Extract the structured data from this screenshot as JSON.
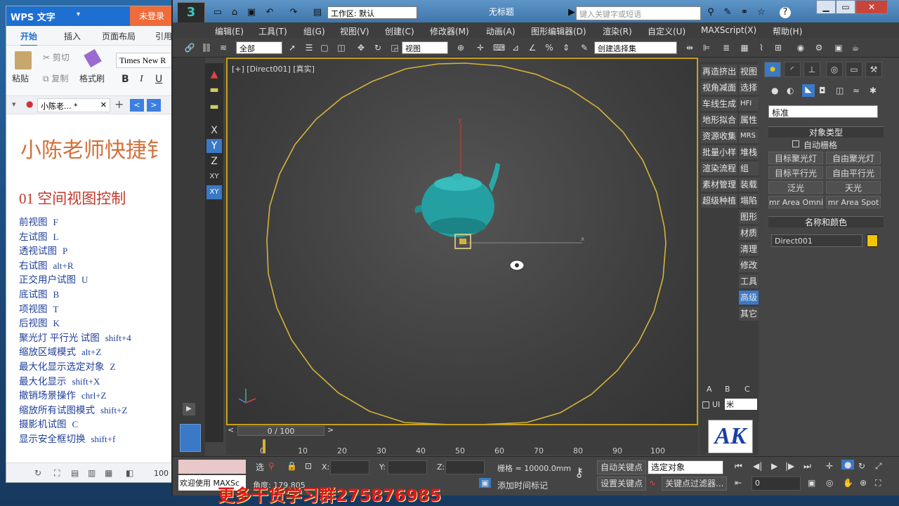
{
  "wps": {
    "app_name": "WPS 文字",
    "login": "未登录",
    "tabs": [
      "开始",
      "插入",
      "页面布局",
      "引用"
    ],
    "ribbon": {
      "paste": "粘贴",
      "cut": "剪切",
      "copy": "复制",
      "format_painter": "格式刷",
      "font": "Times New R",
      "bold": "B",
      "italic": "I",
      "underline": "U"
    },
    "doc_tab": "小陈老... *",
    "doc": {
      "title": "小陈老师快捷钅",
      "section": "01 空间视图控制",
      "lines": [
        {
          "name": "前视图",
          "key": "F"
        },
        {
          "name": "左试图",
          "key": "L"
        },
        {
          "name": "透视试图",
          "key": "P"
        },
        {
          "name": "右试图",
          "key": "alt+R"
        },
        {
          "name": "正交用户试图",
          "key": "U"
        },
        {
          "name": "底试图",
          "key": "B"
        },
        {
          "name": "项视图",
          "key": "T"
        },
        {
          "name": "后视图",
          "key": "K"
        },
        {
          "name": "聚光灯 平行光 试图",
          "key": "shift+4"
        },
        {
          "name": "缩放区域模式",
          "key": "alt+Z"
        },
        {
          "name": "最大化显示选定对象",
          "key": "Z"
        },
        {
          "name": "最大化显示",
          "key": "shift+X"
        },
        {
          "name": "撤销场景操作",
          "key": "chrl+Z"
        },
        {
          "name": "缩放所有试图模式",
          "key": "shift+Z"
        },
        {
          "name": "摄影机试图",
          "key": "C"
        },
        {
          "name": "显示安全框切换",
          "key": "shift+f"
        }
      ]
    },
    "zoom": "100"
  },
  "max": {
    "workspace": "工作区: 默认",
    "title": "无标题",
    "search_placeholder": "键入关键字或短语",
    "menu": [
      "编辑(E)",
      "工具(T)",
      "组(G)",
      "视图(V)",
      "创建(C)",
      "修改器(M)",
      "动画(A)",
      "图形编辑器(D)",
      "渲染(R)",
      "自定义(U)",
      "MAXScript(X)",
      "帮助(H)"
    ],
    "toolbar": {
      "filter": "全部",
      "ref_coord": "视图",
      "selection_set": "创建选择集"
    },
    "axes": [
      "X",
      "Y",
      "Z",
      "XY",
      "XY"
    ],
    "viewport_label": "[+] [Direct001] [真实]",
    "util1": [
      "再造挤出",
      "视角减面",
      "车线生成",
      "地形拟合",
      "资源收集",
      "批量小样",
      "渲染流程",
      "素材管理",
      "超级种植"
    ],
    "util2": [
      "视图",
      "选择",
      "HFI",
      "属性",
      "MRS",
      "堆栈",
      "组",
      "装载",
      "塌陷",
      "图形",
      "材质",
      "清理",
      "修改",
      "工具",
      "高级",
      "其它"
    ],
    "util_footer": {
      "a": "A",
      "b": "B",
      "c": "C",
      "ui": "UI",
      "unit": "米"
    },
    "cmd": {
      "category": "标准",
      "object_type": "对象类型",
      "autogrid": "自动栅格",
      "lights": [
        "目标聚光灯",
        "自由聚光灯",
        "目标平行光",
        "自由平行光",
        "泛光",
        "天光",
        "mr Area Omni",
        "mr Area Spot"
      ],
      "name_color": "名称和颜色",
      "object_name": "Direct001",
      "color": "#f5c400"
    },
    "timeslider": "0 / 100",
    "ticks": [
      "0",
      "10",
      "20",
      "30",
      "40",
      "50",
      "60",
      "70",
      "80",
      "90",
      "100"
    ],
    "status": {
      "welcome": "欢迎使用 MAXSc",
      "x_label": "X:",
      "y_label": "Y:",
      "z_label": "Z:",
      "grid": "栅格 = 10000.0mm",
      "auto_key": "自动关键点",
      "set_key": "设置关键点",
      "selected": "选定对象",
      "key_filters": "关键点过滤器...",
      "add_time_tag": "添加时间标记",
      "angle": "角度: 179.805",
      "frame": "0"
    },
    "watermark": "更多干货学习群275876985",
    "logo_text": "AK"
  }
}
